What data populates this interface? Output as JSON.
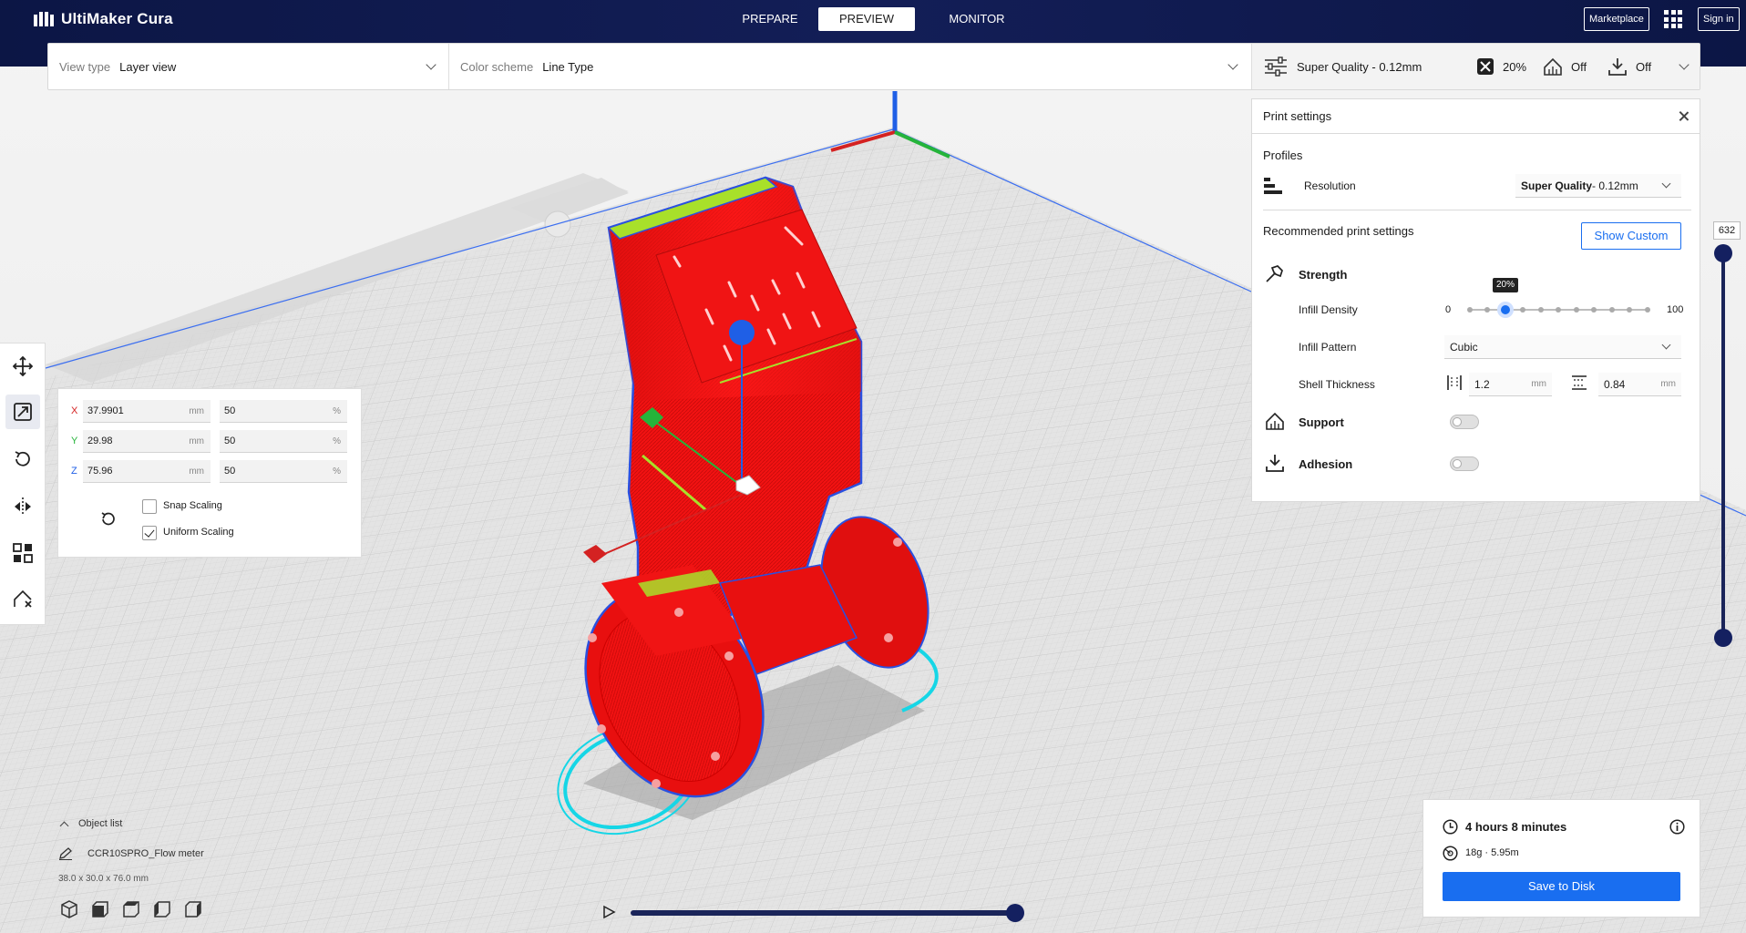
{
  "app": {
    "title": "UltiMaker Cura"
  },
  "header": {
    "stages": [
      "PREPARE",
      "PREVIEW",
      "MONITOR"
    ],
    "active_stage": "PREVIEW",
    "marketplace_label": "Marketplace",
    "signin_label": "Sign in"
  },
  "viewbar": {
    "view_type_label": "View type",
    "view_type_value": "Layer view",
    "color_scheme_label": "Color scheme",
    "color_scheme_value": "Line Type"
  },
  "print_summary": {
    "profile": "Super Quality - 0.12mm",
    "infill": "20%",
    "support": "Off",
    "adhesion": "Off"
  },
  "print_settings": {
    "title": "Print settings",
    "profiles_label": "Profiles",
    "resolution_label": "Resolution",
    "resolution_value_bold": "Super Quality",
    "resolution_value_rest": " - 0.12mm",
    "recommended_label": "Recommended print settings",
    "show_custom_label": "Show Custom",
    "strength_label": "Strength",
    "infill_density_label": "Infill Density",
    "infill_min": "0",
    "infill_max": "100",
    "infill_value_label": "20%",
    "infill_fraction": 0.2,
    "infill_pattern_label": "Infill Pattern",
    "infill_pattern_value": "Cubic",
    "shell_thickness_label": "Shell Thickness",
    "wall_thickness": "1.2",
    "top_bottom_thickness": "0.84",
    "unit": "mm",
    "support_label": "Support",
    "support_enabled": false,
    "adhesion_label": "Adhesion",
    "adhesion_enabled": false
  },
  "scale_tool": {
    "x_label": "X",
    "x_mm": "37.9901",
    "x_pct": "50",
    "y_label": "Y",
    "y_mm": "29.98",
    "y_pct": "50",
    "z_label": "Z",
    "z_mm": "75.96",
    "z_pct": "50",
    "mm_unit": "mm",
    "pct_unit": "%",
    "snap_scaling_label": "Snap Scaling",
    "snap_scaling": false,
    "uniform_scaling_label": "Uniform Scaling",
    "uniform_scaling": true
  },
  "layer_view": {
    "current_layer": "632"
  },
  "object_list": {
    "title": "Object list",
    "object_name": "CCR10SPRO_Flow meter",
    "dimensions": "38.0 x 30.0 x 76.0 mm"
  },
  "job": {
    "time": "4 hours 8 minutes",
    "material": "18g · 5.95m",
    "save_label": "Save to Disk"
  },
  "colors": {
    "header_bg": "#0e1a4d",
    "accent": "#196ef0",
    "model": "#ff1a1a",
    "travel": "#16d6e6",
    "slider": "#1a2459"
  }
}
